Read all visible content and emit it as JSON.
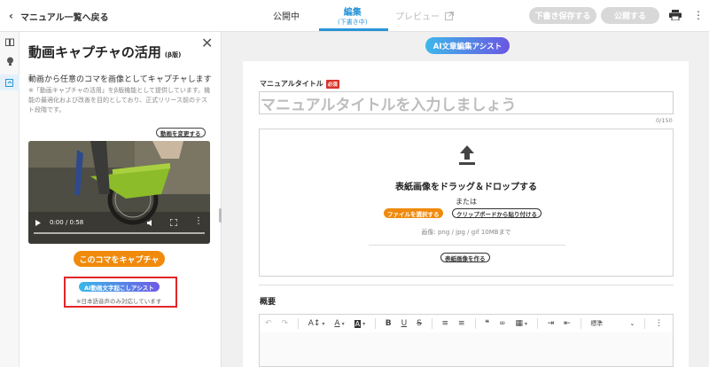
{
  "header": {
    "back_label": "マニュアル一覧へ戻る",
    "tab_public": "公開中",
    "tab_edit": "編集",
    "tab_edit_sub": "(下書き中)",
    "tab_preview": "プレビュー",
    "btn_draft": "下書き保存する",
    "btn_publish": "公開する"
  },
  "panel": {
    "title": "動画キャプチャの活用",
    "beta": "(β版)",
    "description": "動画から任意のコマを画像としてキャプチャします",
    "note": "※「動画キャプチャの活用」をβ版機能として提供しています。機能の最適化および改善を目的としており、正式リリース前のテスト段階です。",
    "change_video": "動画を変更する",
    "video_time": "0:00 / 0:58",
    "capture_button": "このコマをキャプチャ",
    "transcribe_button": "AI動画文字起こしアシスト",
    "transcribe_note": "※日本語音声のみ対応しています"
  },
  "main": {
    "ai_assist": "AI文章編集アシスト",
    "title_label": "マニュアルタイトル",
    "required": "必須",
    "title_placeholder": "マニュアルタイトルを入力しましょう",
    "counter": "0/150",
    "cover_main": "表紙画像をドラッグ＆ドロップする",
    "cover_or": "または",
    "btn_file": "ファイルを選択する",
    "btn_paste": "クリップボードから貼り付ける",
    "cover_format": "画像: png / jpg / gif 10MBまで",
    "btn_make_cover": "表紙画像を作る",
    "summary_label": "概要",
    "style_select": "標準"
  },
  "colors": {
    "accent_blue": "#2a95d8",
    "orange": "#f08a0c",
    "highlight_red": "#e3252b"
  }
}
